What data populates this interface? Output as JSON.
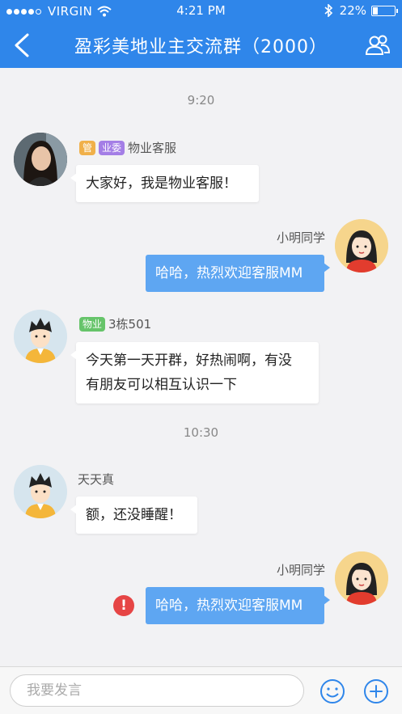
{
  "status_bar": {
    "carrier": "VIRGIN",
    "time": "4:21 PM",
    "battery": "22%",
    "battery_level": 0.22
  },
  "header": {
    "title": "盈彩美地业主交流群（2000）",
    "back_icon": "chevron-left-icon",
    "members_icon": "group-icon"
  },
  "timestamps": [
    "9:20",
    "10:30"
  ],
  "messages": [
    {
      "side": "left",
      "tags": [
        "管",
        "业委"
      ],
      "sender": "物业客服",
      "text": "大家好，我是物业客服！"
    },
    {
      "side": "right",
      "sender": "小明同学",
      "text": "哈哈，热烈欢迎客服MM"
    },
    {
      "side": "left",
      "tags": [
        "物业"
      ],
      "sender": "3栋501",
      "text": "今天第一天开群，好热闹啊，有没有朋友可以相互认识一下",
      "text_line1": "今天第一天开群，好热闹啊，有没",
      "text_line2": "有朋友可以相互认识一下"
    },
    {
      "side": "left",
      "sender": "天天真",
      "text": "额，还没睡醒！"
    },
    {
      "side": "right",
      "sender": "小明同学",
      "text": "哈哈，热烈欢迎客服MM",
      "error_mark": "!"
    }
  ],
  "input_bar": {
    "placeholder": "我要发言",
    "emoji_icon": "smiley-icon",
    "plus_icon": "plus-circle-icon"
  },
  "colors": {
    "header_blue": "#2f86ea",
    "bubble_blue": "#5ea6f2",
    "background": "#f2f2f4",
    "error_red": "#e64545"
  }
}
